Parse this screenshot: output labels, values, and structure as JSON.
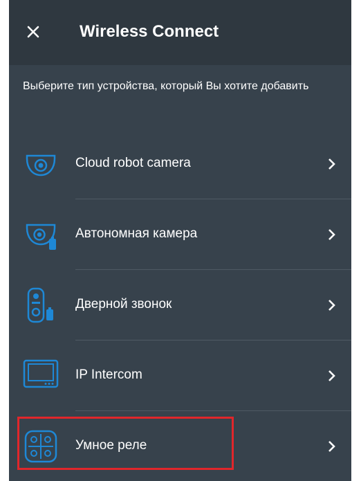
{
  "header": {
    "title": "Wireless Connect"
  },
  "subtitle": "Выберите тип устройства, который Вы хотите добавить",
  "items": [
    {
      "label": "Cloud robot camera",
      "icon": "dome-camera-icon"
    },
    {
      "label": "Автономная камера",
      "icon": "battery-camera-icon"
    },
    {
      "label": "Дверной звонок",
      "icon": "doorbell-icon"
    },
    {
      "label": "IP Intercom",
      "icon": "intercom-icon"
    },
    {
      "label": "Умное реле",
      "icon": "smart-relay-icon"
    }
  ],
  "colors": {
    "background": "#37424c",
    "header": "#2f3840",
    "accent": "#1e88d6",
    "highlight": "#e0262b"
  }
}
